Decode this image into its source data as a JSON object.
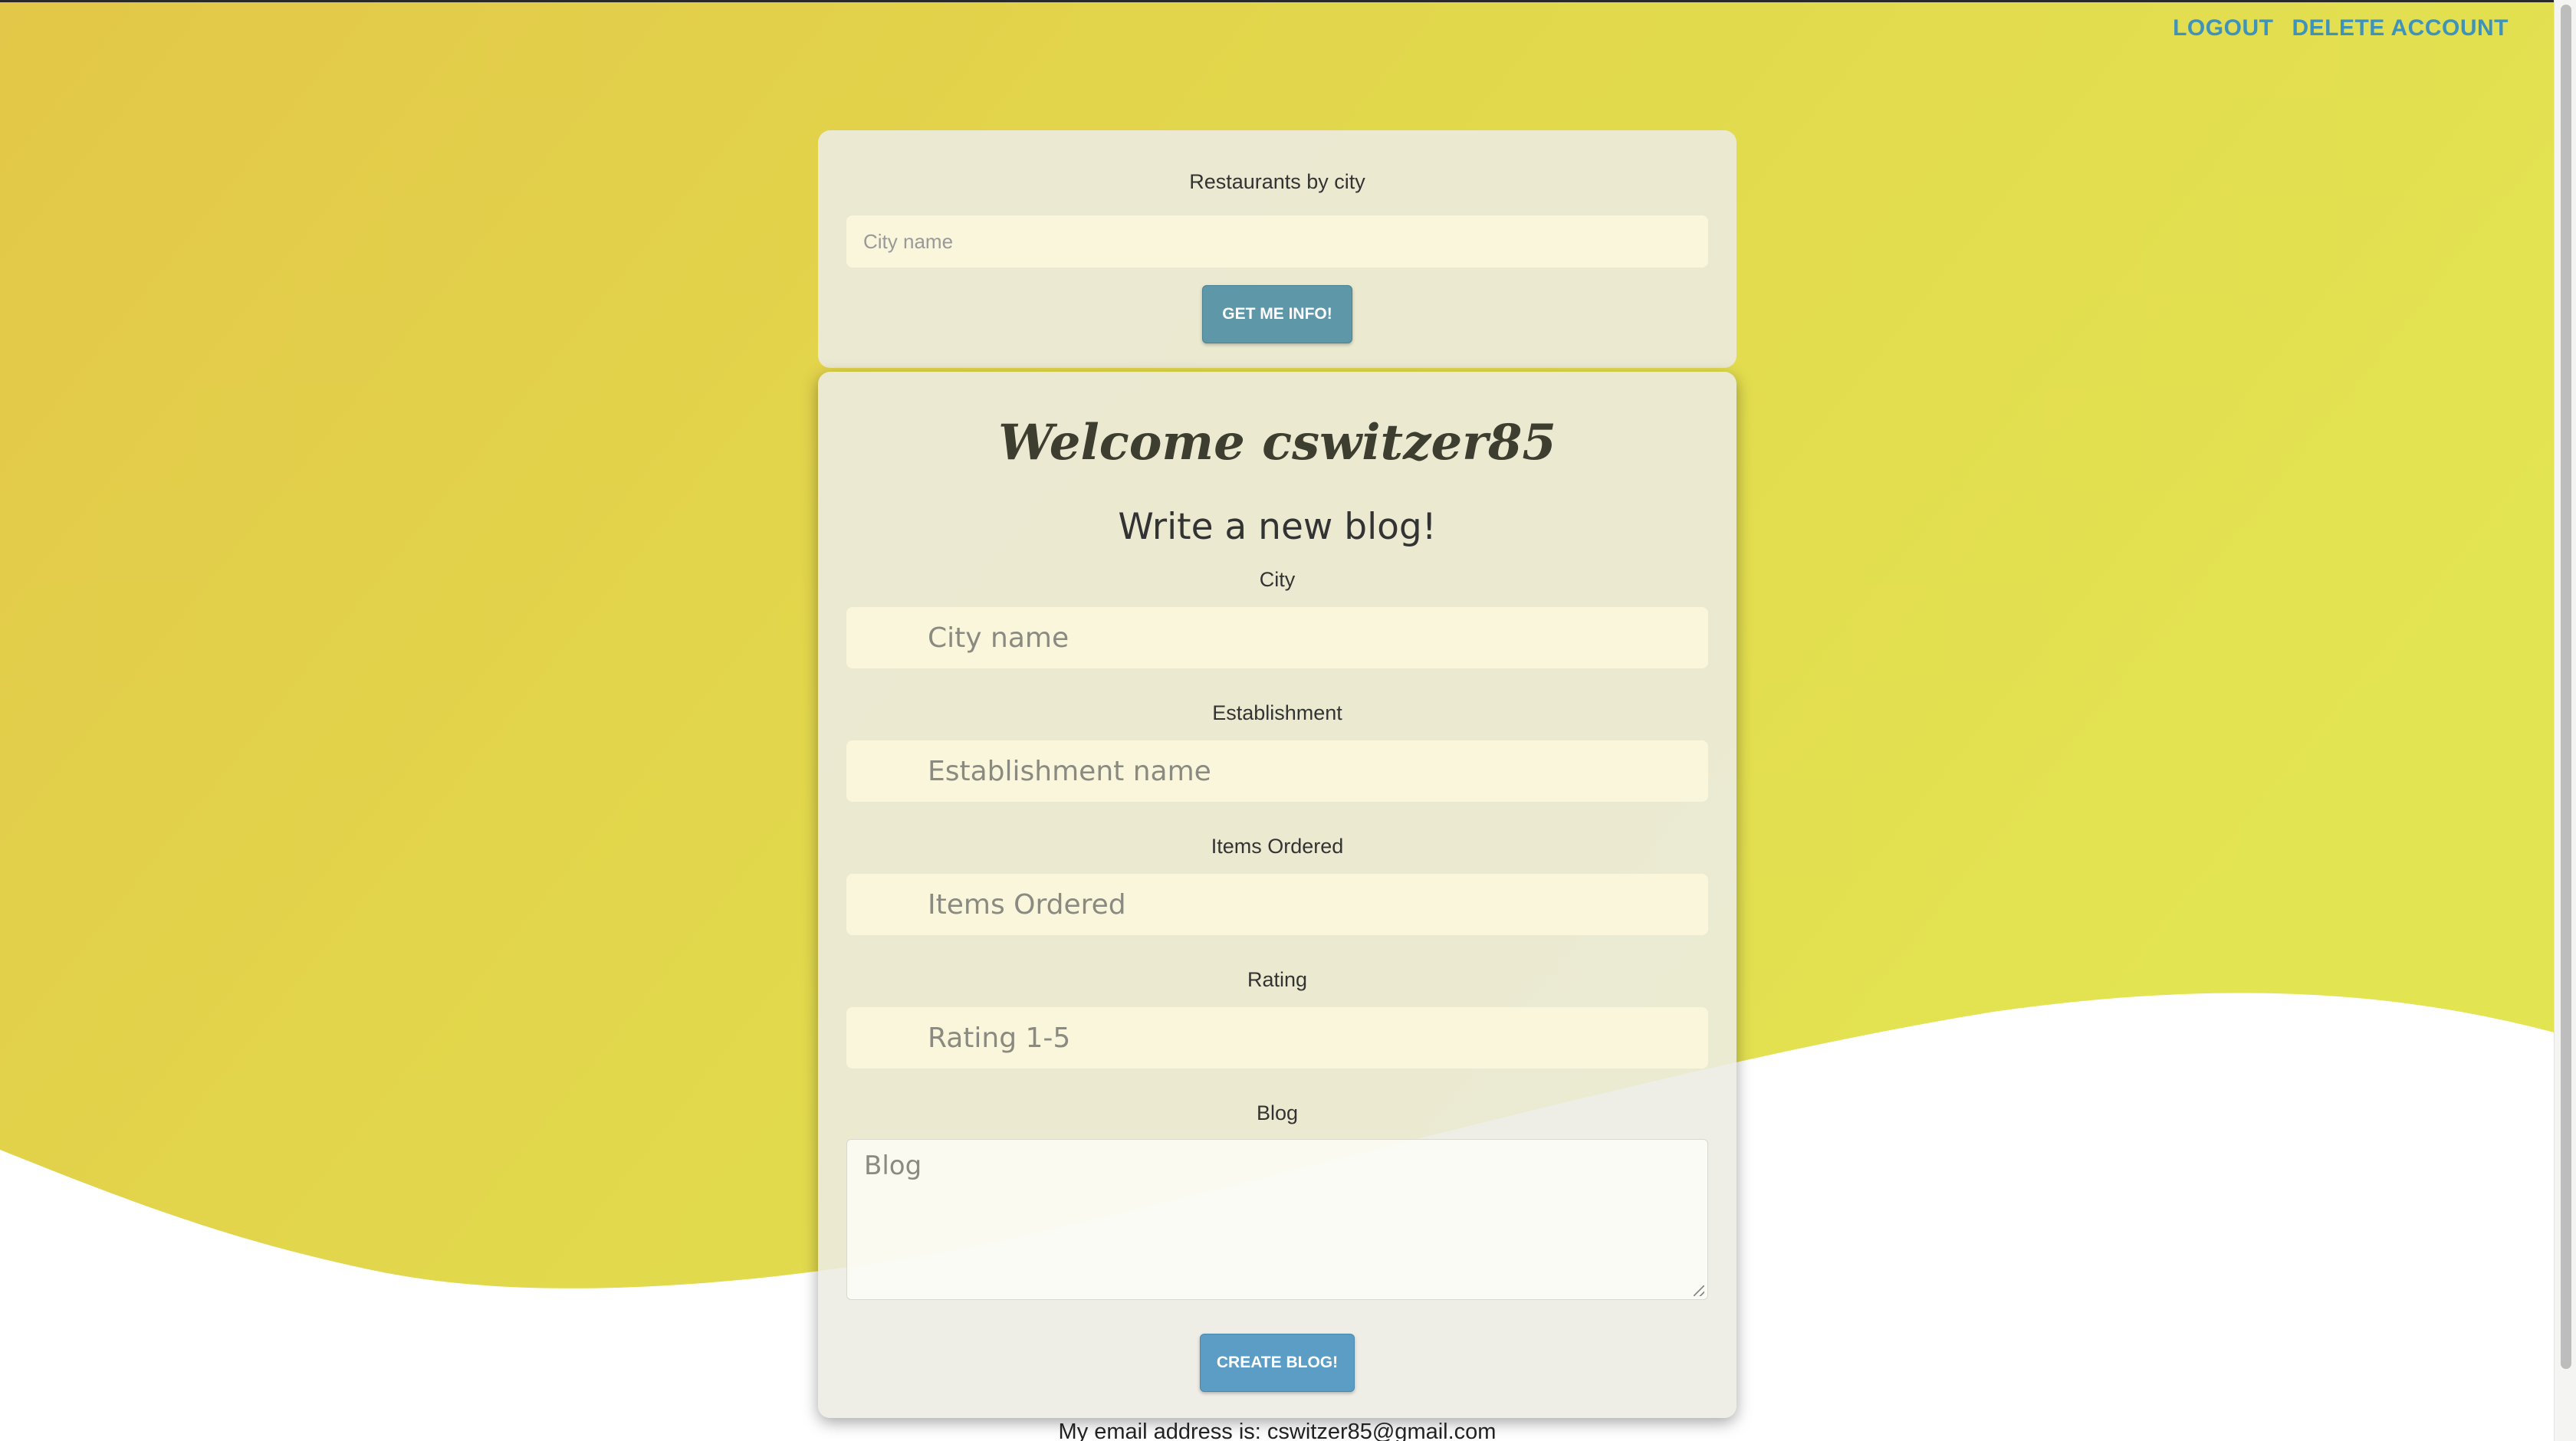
{
  "nav": {
    "logout_label": "LOGOUT",
    "delete_label": "DELETE ACCOUNT"
  },
  "search": {
    "title": "Restaurants by city",
    "placeholder": "City name",
    "button_label": "GET ME INFO!"
  },
  "blog_form": {
    "welcome": "Welcome cswitzer85",
    "subtitle": "Write a new blog!",
    "fields": [
      {
        "label": "City",
        "placeholder": "City name"
      },
      {
        "label": "Establishment",
        "placeholder": "Establishment name"
      },
      {
        "label": "Items Ordered",
        "placeholder": "Items Ordered"
      },
      {
        "label": "Rating",
        "placeholder": "Rating 1-5"
      }
    ],
    "blog_label": "Blog",
    "blog_placeholder": "Blog",
    "create_label": "CREATE BLOG!"
  },
  "footer": {
    "email_text": "My email address is: cswitzer85@gmail.com"
  },
  "colors": {
    "accent_link": "#3f93b8",
    "button": "#5d97a8",
    "background_yellow": "#e3d84c"
  }
}
